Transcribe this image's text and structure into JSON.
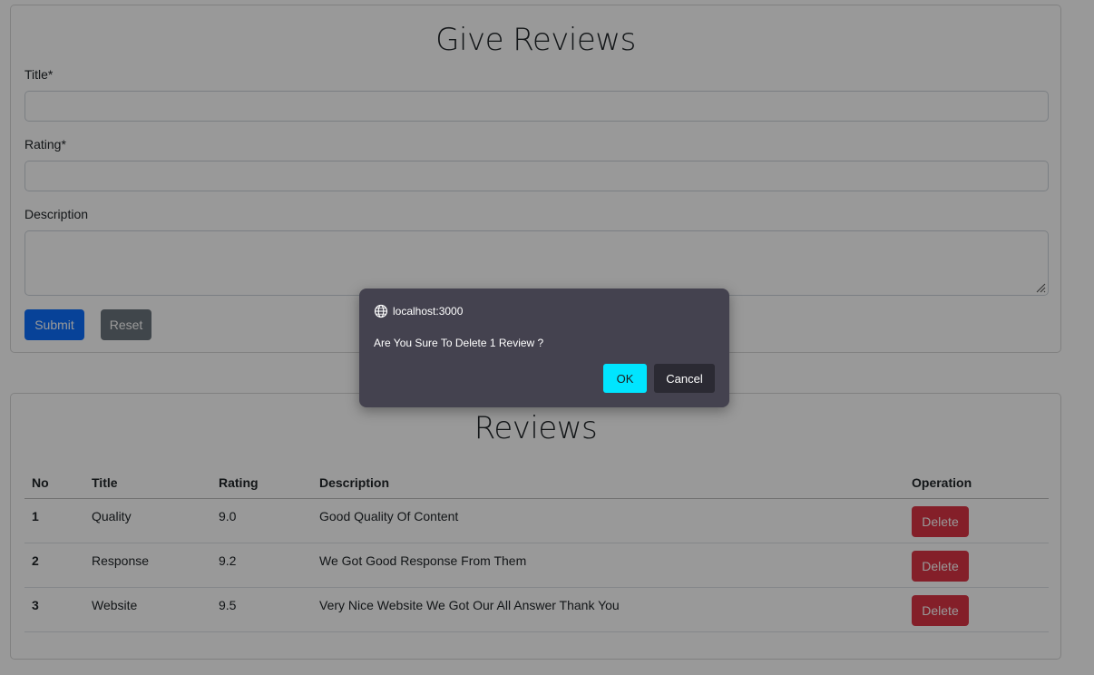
{
  "form": {
    "heading": "Give Reviews",
    "title_label": "Title*",
    "title_value": "",
    "rating_label": "Rating*",
    "rating_value": "",
    "description_label": "Description",
    "description_value": "",
    "submit_label": "Submit",
    "reset_label": "Reset"
  },
  "reviews": {
    "heading": "Reviews",
    "columns": [
      "No",
      "Title",
      "Rating",
      "Description",
      "Operation"
    ],
    "rows": [
      {
        "no": "1",
        "title": "Quality",
        "rating": "9.0",
        "description": "Good Quality Of Content",
        "action": "Delete"
      },
      {
        "no": "2",
        "title": "Response",
        "rating": "9.2",
        "description": "We Got Good Response From Them",
        "action": "Delete"
      },
      {
        "no": "3",
        "title": "Website",
        "rating": "9.5",
        "description": "Very Nice Website We Got Our All Answer Thank You",
        "action": "Delete"
      }
    ]
  },
  "dialog": {
    "origin": "localhost:3000",
    "origin_icon": "globe-icon",
    "message": "Are You Sure To Delete 1 Review ?",
    "ok_label": "OK",
    "cancel_label": "Cancel"
  },
  "colors": {
    "primary": "#0d6efd",
    "secondary": "#6c757d",
    "danger": "#dc3545",
    "dialog_bg": "#44424f",
    "dialog_ok": "#00e5ff"
  }
}
